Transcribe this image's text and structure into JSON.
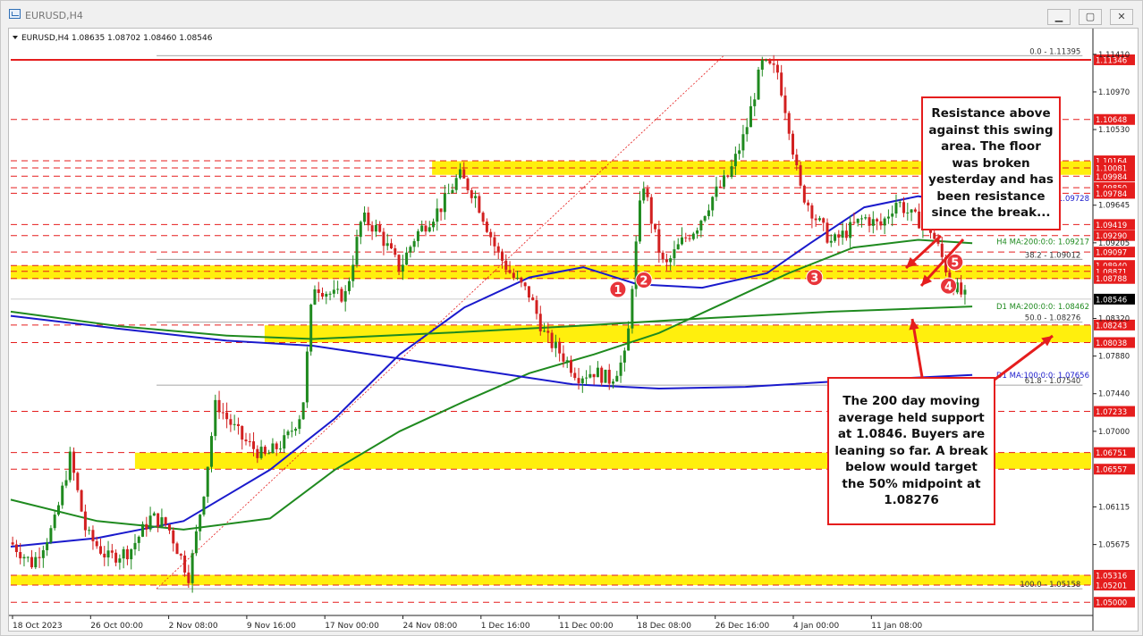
{
  "window": {
    "title": "EURUSD,H4",
    "buttons": {
      "minimize": "▁",
      "maximize": "▢",
      "close": "✕"
    }
  },
  "chart_data": {
    "type": "candlestick",
    "symbol_header": "EURUSD,H4  1.08635 1.08702 1.08460 1.08546",
    "ylim": [
      1.0495,
      1.1145
    ],
    "current_price": "1.08546",
    "price_ticks": [
      "1.11410",
      "1.10970",
      "1.10530",
      "1.09645",
      "1.09205",
      "1.08320",
      "1.07880",
      "1.07440",
      "1.07000",
      "1.06115",
      "1.05675"
    ],
    "time_labels": [
      "18 Oct 2023",
      "26 Oct 00:00",
      "2 Nov 08:00",
      "9 Nov 16:00",
      "17 Nov 00:00",
      "24 Nov 08:00",
      "1 Dec 16:00",
      "11 Dec 00:00",
      "18 Dec 08:00",
      "26 Dec 16:00",
      "4 Jan 00:00",
      "11 Jan 08:00"
    ],
    "horizontal_levels": [
      {
        "price": 1.11346,
        "label": "1.11346",
        "style": "solid",
        "color": "#e51d1d"
      },
      {
        "price": 1.10648,
        "label": "1.10648",
        "style": "dashed",
        "color": "#e51d1d"
      },
      {
        "price": 1.10164,
        "label": "1.10164",
        "style": "dashed",
        "color": "#e51d1d"
      },
      {
        "price": 1.10081,
        "label": "1.10081",
        "style": "dashed",
        "color": "#e51d1d"
      },
      {
        "price": 1.09984,
        "label": "1.09984",
        "style": "dashed",
        "color": "#e51d1d"
      },
      {
        "price": 1.0985,
        "label": "1.09850",
        "style": "dashed",
        "color": "#e51d1d"
      },
      {
        "price": 1.09784,
        "label": "1.09784",
        "style": "dashed",
        "color": "#e51d1d"
      },
      {
        "price": 1.09419,
        "label": "1.09419",
        "style": "dashed",
        "color": "#e51d1d"
      },
      {
        "price": 1.0929,
        "label": "1.09290",
        "style": "dashed",
        "color": "#e51d1d"
      },
      {
        "price": 1.09097,
        "label": "1.09097",
        "style": "dashed",
        "color": "#e51d1d"
      },
      {
        "price": 1.0894,
        "label": "1.08940",
        "style": "dashed",
        "color": "#e51d1d"
      },
      {
        "price": 1.08871,
        "label": "1.08871",
        "style": "dashed",
        "color": "#e51d1d"
      },
      {
        "price": 1.08788,
        "label": "1.08788",
        "style": "dashed",
        "color": "#e51d1d"
      },
      {
        "price": 1.08243,
        "label": "1.08243",
        "style": "dashed",
        "color": "#e51d1d"
      },
      {
        "price": 1.08038,
        "label": "1.08038",
        "style": "dashed",
        "color": "#e51d1d"
      },
      {
        "price": 1.07233,
        "label": "1.07233",
        "style": "dashed",
        "color": "#e51d1d"
      },
      {
        "price": 1.06751,
        "label": "1.06751",
        "style": "dashed",
        "color": "#e51d1d"
      },
      {
        "price": 1.06557,
        "label": "1.06557",
        "style": "dashed",
        "color": "#e51d1d"
      },
      {
        "price": 1.05316,
        "label": "1.05316",
        "style": "dashed",
        "color": "#e51d1d"
      },
      {
        "price": 1.05201,
        "label": "1.05201",
        "style": "dashed",
        "color": "#e51d1d"
      },
      {
        "price": 1.05,
        "label": "1.05000",
        "style": "dashed",
        "color": "#e51d1d"
      }
    ],
    "zones": [
      {
        "from_price": 1.1,
        "to_price": 1.1016,
        "start_time": 0.39
      },
      {
        "from_price": 1.0878,
        "to_price": 1.0894,
        "start_time": 0.0
      },
      {
        "from_price": 1.0804,
        "to_price": 1.0824,
        "start_time": 0.235
      },
      {
        "from_price": 1.0656,
        "to_price": 1.0675,
        "start_time": 0.115
      },
      {
        "from_price": 1.052,
        "to_price": 1.0532,
        "start_time": 0.0
      }
    ],
    "fib_levels": [
      {
        "label": "0.0 - 1.11395",
        "price": 1.11395
      },
      {
        "label": "38.2 - 1.09012",
        "price": 1.09012
      },
      {
        "label": "50.0 - 1.08276",
        "price": 1.08276
      },
      {
        "label": "61.8 - 1.07540",
        "price": 1.0754
      },
      {
        "label": "100.0 - 1.05158",
        "price": 1.05158
      }
    ],
    "ma_labels": [
      {
        "label": "1.09728",
        "price": 1.09728,
        "color": "#1a1acc"
      },
      {
        "label": "H4 MA:200:0:0: 1.09217",
        "price": 1.09217,
        "color": "#1f8a1f"
      },
      {
        "label": "D1 MA:200:0:0: 1.08462",
        "price": 1.08462,
        "color": "#1f8a1f"
      },
      {
        "label": "D1 MA:100:0:0: 1.07656",
        "price": 1.07656,
        "color": "#1a1acc"
      }
    ],
    "swing_markers": [
      {
        "label": "1",
        "time": 0.562,
        "price": 1.0866
      },
      {
        "label": "2",
        "time": 0.586,
        "price": 1.0877
      },
      {
        "label": "3",
        "time": 0.744,
        "price": 1.088
      },
      {
        "label": "4",
        "time": 0.868,
        "price": 1.087
      },
      {
        "label": "5",
        "time": 0.874,
        "price": 1.0898
      }
    ],
    "price_path": [
      [
        0.0,
        1.057
      ],
      [
        0.02,
        1.0545
      ],
      [
        0.04,
        1.059
      ],
      [
        0.055,
        1.067
      ],
      [
        0.07,
        1.058
      ],
      [
        0.09,
        1.0552
      ],
      [
        0.11,
        1.056
      ],
      [
        0.13,
        1.06
      ],
      [
        0.145,
        1.059
      ],
      [
        0.165,
        1.053
      ],
      [
        0.18,
        1.064
      ],
      [
        0.19,
        1.0735
      ],
      [
        0.2,
        1.0715
      ],
      [
        0.215,
        1.069
      ],
      [
        0.235,
        1.067
      ],
      [
        0.255,
        1.069
      ],
      [
        0.27,
        1.0725
      ],
      [
        0.28,
        1.0872
      ],
      [
        0.3,
        1.0858
      ],
      [
        0.31,
        1.086
      ],
      [
        0.325,
        1.095
      ],
      [
        0.34,
        1.0935
      ],
      [
        0.36,
        1.089
      ],
      [
        0.375,
        1.093
      ],
      [
        0.4,
        1.0965
      ],
      [
        0.415,
        1.1
      ],
      [
        0.43,
        1.0975
      ],
      [
        0.45,
        1.091
      ],
      [
        0.465,
        1.088
      ],
      [
        0.48,
        1.086
      ],
      [
        0.495,
        1.081
      ],
      [
        0.51,
        1.079
      ],
      [
        0.525,
        1.0765
      ],
      [
        0.54,
        1.077
      ],
      [
        0.555,
        1.076
      ],
      [
        0.57,
        1.079
      ],
      [
        0.575,
        1.087
      ],
      [
        0.585,
        1.0995
      ],
      [
        0.595,
        1.0935
      ],
      [
        0.605,
        1.089
      ],
      [
        0.62,
        1.092
      ],
      [
        0.635,
        1.094
      ],
      [
        0.65,
        1.0975
      ],
      [
        0.665,
        1.1
      ],
      [
        0.68,
        1.105
      ],
      [
        0.695,
        1.113
      ],
      [
        0.71,
        1.112
      ],
      [
        0.72,
        1.106
      ],
      [
        0.73,
        1.0985
      ],
      [
        0.745,
        1.095
      ],
      [
        0.76,
        1.092
      ],
      [
        0.775,
        1.0935
      ],
      [
        0.79,
        1.095
      ],
      [
        0.805,
        1.094
      ],
      [
        0.82,
        1.097
      ],
      [
        0.835,
        1.095
      ],
      [
        0.85,
        1.094
      ],
      [
        0.86,
        1.091
      ],
      [
        0.87,
        1.0875
      ],
      [
        0.88,
        1.086
      ],
      [
        0.885,
        1.0855
      ]
    ],
    "moving_averages": [
      {
        "name": "H4 MA 100",
        "color": "#1a1acc",
        "points": [
          [
            0.0,
            1.0565
          ],
          [
            0.08,
            1.0575
          ],
          [
            0.16,
            1.0595
          ],
          [
            0.24,
            1.0655
          ],
          [
            0.3,
            1.0715
          ],
          [
            0.36,
            1.079
          ],
          [
            0.42,
            1.0845
          ],
          [
            0.48,
            1.088
          ],
          [
            0.53,
            1.0892
          ],
          [
            0.58,
            1.0872
          ],
          [
            0.64,
            1.0868
          ],
          [
            0.7,
            1.0885
          ],
          [
            0.74,
            1.092
          ],
          [
            0.79,
            1.0962
          ],
          [
            0.84,
            1.0975
          ],
          [
            0.89,
            1.0966
          ]
        ]
      },
      {
        "name": "H4 MA 200",
        "color": "#1f8a1f",
        "points": [
          [
            0.0,
            1.062
          ],
          [
            0.08,
            1.0595
          ],
          [
            0.16,
            1.0585
          ],
          [
            0.24,
            1.0598
          ],
          [
            0.3,
            1.0655
          ],
          [
            0.36,
            1.07
          ],
          [
            0.42,
            1.0735
          ],
          [
            0.48,
            1.0768
          ],
          [
            0.54,
            1.079
          ],
          [
            0.6,
            1.0815
          ],
          [
            0.66,
            1.085
          ],
          [
            0.72,
            1.0885
          ],
          [
            0.78,
            1.0915
          ],
          [
            0.84,
            1.0924
          ],
          [
            0.89,
            1.092
          ]
        ]
      },
      {
        "name": "D1 MA 200",
        "color": "#1f8a1f",
        "points": [
          [
            0.0,
            1.084
          ],
          [
            0.1,
            1.0823
          ],
          [
            0.2,
            1.0812
          ],
          [
            0.28,
            1.0808
          ],
          [
            0.4,
            1.0815
          ],
          [
            0.52,
            1.0823
          ],
          [
            0.64,
            1.0832
          ],
          [
            0.76,
            1.084
          ],
          [
            0.89,
            1.0846
          ]
        ]
      },
      {
        "name": "D1 MA 100",
        "color": "#1a1acc",
        "points": [
          [
            0.0,
            1.0835
          ],
          [
            0.1,
            1.082
          ],
          [
            0.2,
            1.0806
          ],
          [
            0.28,
            1.08
          ],
          [
            0.36,
            1.0785
          ],
          [
            0.44,
            1.077
          ],
          [
            0.52,
            1.0755
          ],
          [
            0.6,
            1.075
          ],
          [
            0.68,
            1.0752
          ],
          [
            0.76,
            1.0758
          ],
          [
            0.89,
            1.0766
          ]
        ]
      }
    ],
    "annotation_top": "Resistance above against this swing area. The floor was broken yesterday and has been resistance since the break...",
    "annotation_bottom": "The 200 day moving average held support at 1.0846. Buyers are leaning so far. A break below would target the 50% midpoint at 1.08276"
  }
}
